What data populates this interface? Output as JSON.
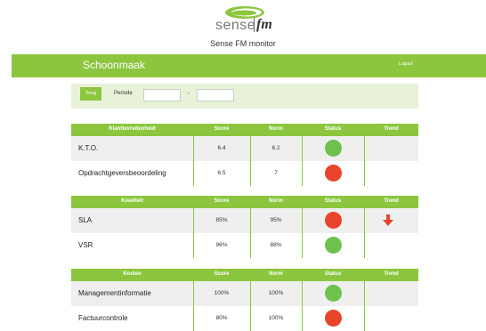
{
  "header": {
    "logo_text": "sense",
    "logo_fm": "fm",
    "logo_sub": "facility management",
    "monitor_title": "Sense FM monitor"
  },
  "topbar": {
    "title": "Schoonmaak",
    "logout": "Logout"
  },
  "filter": {
    "back_label": "Terug",
    "period_label": "Periode",
    "from_value": "",
    "separator": "-",
    "to_value": ""
  },
  "colors": {
    "accent": "#8cc63f",
    "status_green": "#6cc24a",
    "status_red": "#e8452c",
    "row_alt": "#efefef"
  },
  "sections": [
    {
      "headers": [
        "Klanttevredenheid",
        "Score",
        "Norm",
        "Status",
        "Trend"
      ],
      "rows": [
        {
          "name": "K.T.O.",
          "score": "6.4",
          "norm": "6.2",
          "status": "green",
          "trend": ""
        },
        {
          "name": "Opdrachtgeversbeoordeling",
          "score": "6.5",
          "norm": "7",
          "status": "red",
          "trend": ""
        }
      ]
    },
    {
      "headers": [
        "Kwaliteit",
        "Score",
        "Norm",
        "Status",
        "Trend"
      ],
      "rows": [
        {
          "name": "SLA",
          "score": "85%",
          "norm": "95%",
          "status": "red",
          "trend": "down-arrow-icon"
        },
        {
          "name": "VSR",
          "score": "96%",
          "norm": "88%",
          "status": "green",
          "trend": ""
        }
      ]
    },
    {
      "headers": [
        "Kosten",
        "Score",
        "Norm",
        "Status",
        "Trend"
      ],
      "rows": [
        {
          "name": "Managementinformatie",
          "score": "100%",
          "norm": "100%",
          "status": "green",
          "trend": ""
        },
        {
          "name": "Factuurcontrole",
          "score": "80%",
          "norm": "100%",
          "status": "red",
          "trend": ""
        }
      ]
    }
  ]
}
